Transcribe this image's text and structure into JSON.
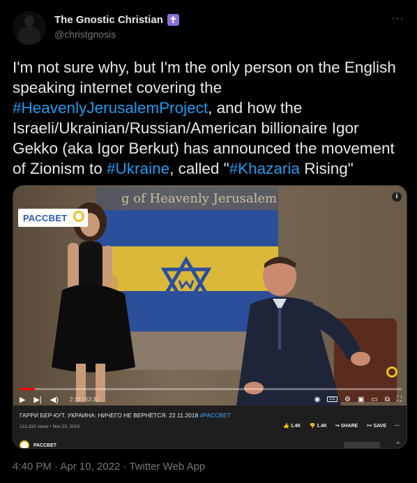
{
  "author": {
    "name": "The Gnostic Christian",
    "badge": "✝",
    "handle": "@christgnosis"
  },
  "more_label": "···",
  "tweet": {
    "part1": "I'm not sure why, but I'm the only person on the English speaking internet covering the ",
    "hashtag1": "#HeavenlyJerusalemProject",
    "part2": ", and how the Israeli/Ukrainian/Russian/American billionaire Igor Gekko (aka Igor Berkut) has announced the movement of Zionism to ",
    "hashtag2": "#Ukraine",
    "part3": ", called \"",
    "hashtag3": "#Khazaria",
    "part4": " Rising\""
  },
  "video": {
    "logo_text": "РАССВЕТ",
    "flag_text": "g of Heavenly Jerusalem",
    "info_label": "i",
    "progress_fraction": 0.04,
    "play_label": "▶",
    "next_label": "▶|",
    "volume_label": "◀)",
    "time": "2:16 / 52:32",
    "cc_label": "CC",
    "title": "ГАРРИ БЕР-КУТ. УКРАИНА: НИЧЕГО НЕ ВЕРНЁТСЯ. 22.11.2018 ",
    "title_tag": "#РАССВЕТ",
    "stats": "121,310 views • Nov 23, 2018",
    "like": "1.4K",
    "dislike": "1.4K",
    "share": "SHARE",
    "save": "SAVE",
    "more": "···",
    "channel_name": "РАССВЕТ"
  },
  "footer": {
    "timestamp": "4:40 PM · Apr 10, 2022 · Twitter Web App"
  },
  "colors": {
    "background": "#000000",
    "text": "#e7e9ea",
    "link": "#1d9bf0",
    "muted": "#71767b",
    "flag_blue": "#2c4f9c",
    "flag_yellow": "#d9b83a",
    "progress": "#ff0000"
  }
}
